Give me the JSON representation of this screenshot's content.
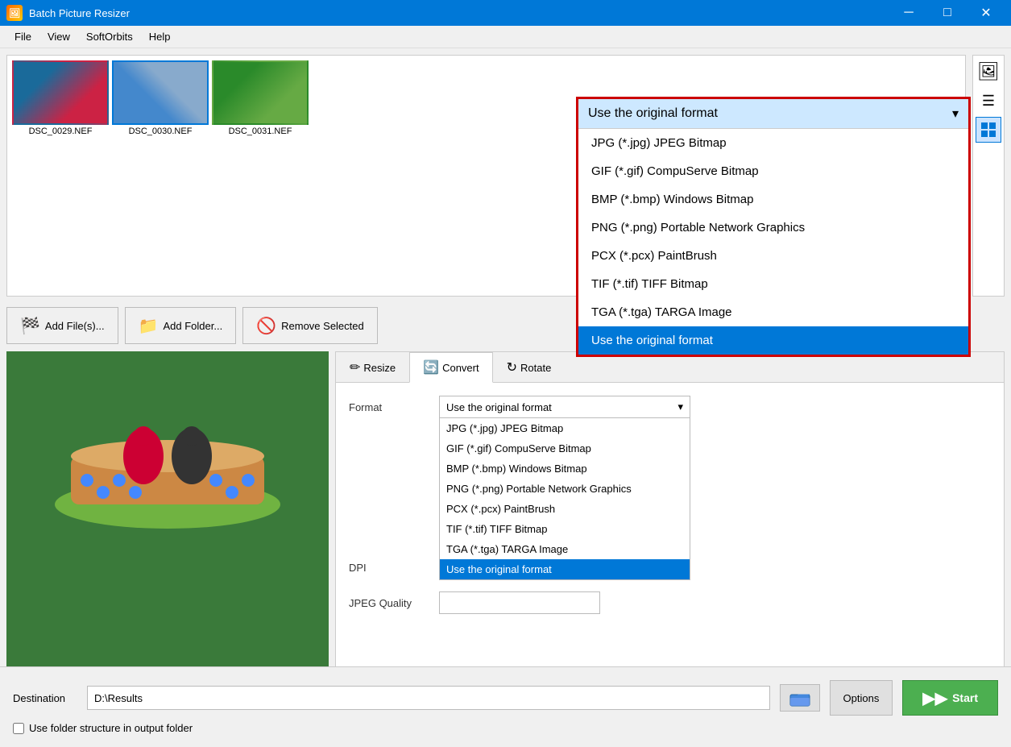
{
  "app": {
    "title": "Batch Picture Resizer",
    "icon": "🖼"
  },
  "titlebar": {
    "minimize": "─",
    "maximize": "□",
    "close": "✕"
  },
  "menubar": {
    "items": [
      "File",
      "View",
      "SoftOrbits",
      "Help"
    ]
  },
  "thumbnails": [
    {
      "label": "DSC_0029.NEF",
      "class": "thumb-dsc29"
    },
    {
      "label": "DSC_0030.NEF",
      "class": "thumb-dsc30"
    },
    {
      "label": "DSC_0031.NEF",
      "class": "thumb-dsc31"
    }
  ],
  "toolbar": {
    "add_files": "Add File(s)...",
    "add_folder": "Add Folder...",
    "remove_selected": "Remove Selected"
  },
  "tabs": [
    {
      "label": "Resize",
      "icon": "✏"
    },
    {
      "label": "Convert",
      "icon": "🔄"
    },
    {
      "label": "Rotate",
      "icon": "↻"
    }
  ],
  "active_tab": "Convert",
  "form": {
    "format_label": "Format",
    "dpi_label": "DPI",
    "jpeg_quality_label": "JPEG Quality"
  },
  "format_options": [
    "Use the original format",
    "JPG (*.jpg) JPEG Bitmap",
    "GIF (*.gif) CompuServe Bitmap",
    "BMP (*.bmp) Windows Bitmap",
    "PNG (*.png) Portable Network Graphics",
    "PCX (*.pcx) PaintBrush",
    "TIF (*.tif) TIFF Bitmap",
    "TGA (*.tga) TARGA Image"
  ],
  "selected_format": "Use the original format",
  "small_dropdown": {
    "selected": "Use the original format",
    "options": [
      "JPG (*.jpg) JPEG Bitmap",
      "GIF (*.gif) CompuServe Bitmap",
      "BMP (*.bmp) Windows Bitmap",
      "PNG (*.png) Portable Network Graphics",
      "PCX (*.pcx) PaintBrush",
      "TIF (*.tif) TIFF Bitmap",
      "TGA (*.tga) TARGA Image",
      "Use the original format"
    ]
  },
  "destination": {
    "label": "Destination",
    "value": "D:\\Results"
  },
  "folder_structure": {
    "label": "Use folder structure in output folder",
    "checked": false
  },
  "buttons": {
    "options": "Options",
    "start": "Start"
  },
  "overlay": {
    "header": "Use the original format",
    "items": [
      "JPG (*.jpg) JPEG Bitmap",
      "GIF (*.gif) CompuServe Bitmap",
      "BMP (*.bmp) Windows Bitmap",
      "PNG (*.png) Portable Network Graphics",
      "PCX (*.pcx) PaintBrush",
      "TIF (*.tif) TIFF Bitmap",
      "TGA (*.tga) TARGA Image",
      "Use the original format"
    ],
    "selected": "Use the original format"
  }
}
